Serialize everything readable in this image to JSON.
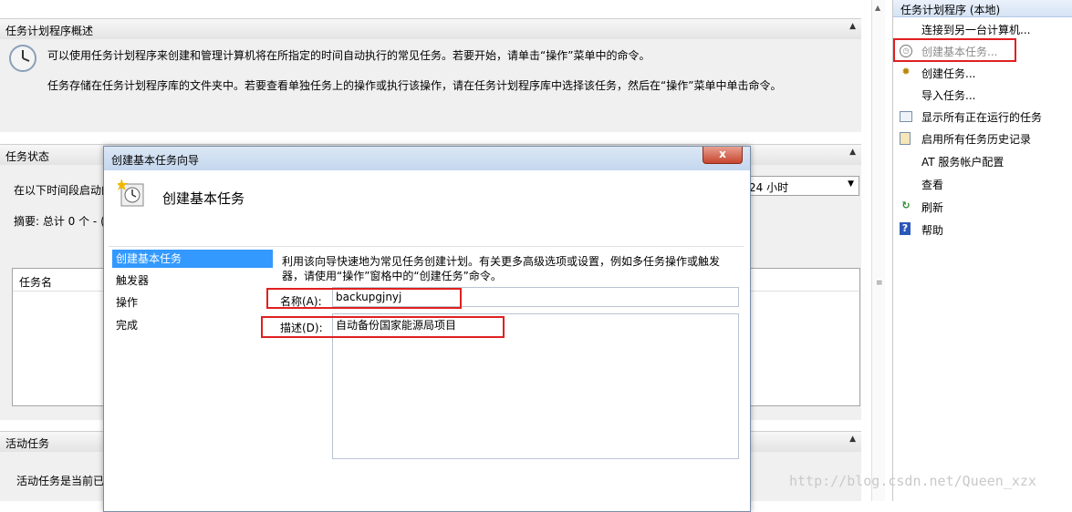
{
  "overview": {
    "header": "任务计划程序概述",
    "line1": "可以使用任务计划程序来创建和管理计算机将在所指定的时间自动执行的常见任务。若要开始，请单击“操作”菜单中的命令。",
    "line2": "任务存储在任务计划程序库的文件夹中。若要查看单独任务上的操作或执行该操作，请在任务计划程序库中选择该任务，然后在“操作”菜单中单击命令。"
  },
  "status": {
    "header": "任务状态",
    "period_label": "在以下时间段启动的",
    "period_value": "24 小时",
    "summary": "摘要: 总计 0 个 - (",
    "table_header": "任务名"
  },
  "active": {
    "header": "活动任务",
    "text": "活动任务是当前已"
  },
  "actions_pane": {
    "header": "任务计划程序 (本地)",
    "items": [
      {
        "label": "连接到另一台计算机...",
        "icon": "none"
      },
      {
        "label": "创建基本任务...",
        "icon": "wizard-clock-icon"
      },
      {
        "label": "创建任务...",
        "icon": "task-icon"
      },
      {
        "label": "导入任务...",
        "icon": "none"
      },
      {
        "label": "显示所有正在运行的任务",
        "icon": "running-list-icon"
      },
      {
        "label": "启用所有任务历史记录",
        "icon": "history-icon"
      },
      {
        "label": "AT 服务帐户配置",
        "icon": "none"
      },
      {
        "label": "查看",
        "icon": "none"
      },
      {
        "label": "刷新",
        "icon": "refresh-icon"
      },
      {
        "label": "帮助",
        "icon": "help-icon"
      }
    ]
  },
  "wizard": {
    "title": "创建基本任务向导",
    "heading": "创建基本任务",
    "close": "x",
    "nav": [
      "创建基本任务",
      "触发器",
      "操作",
      "完成"
    ],
    "intro": "利用该向导快速地为常见任务创建计划。有关更多高级选项或设置，例如多任务操作或触发器，请使用“操作”窗格中的“创建任务”命令。",
    "name_label": "名称(A):",
    "name_value": "backupgjnyj",
    "desc_label": "描述(D):",
    "desc_value": "自动备份国家能源局项目"
  },
  "watermark": "http://blog.csdn.net/Queen_xzx",
  "colors": {
    "highlight_red": "#e02020",
    "selection_blue": "#3399ff"
  }
}
